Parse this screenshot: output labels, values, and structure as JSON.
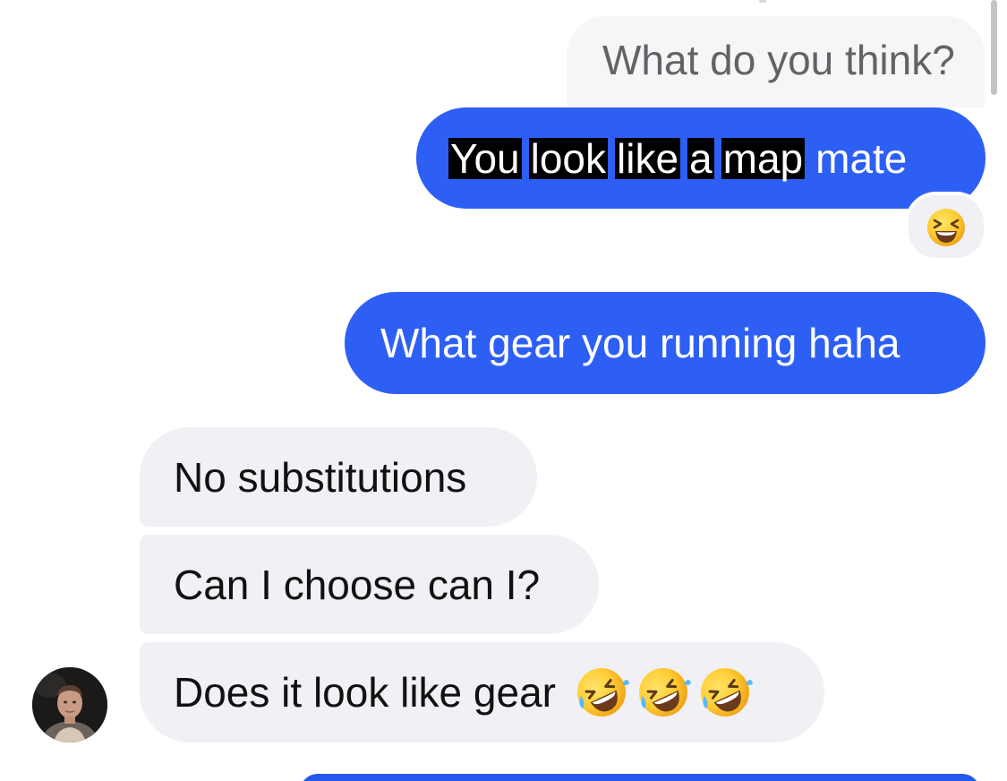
{
  "conversation": {
    "messages": [
      {
        "id": "m1",
        "direction": "outgoing-quoted",
        "text": "What do you think?"
      },
      {
        "id": "m2",
        "direction": "outgoing",
        "highlighted_words": [
          "You",
          "look",
          "like",
          "a",
          "map"
        ],
        "plain_tail": "mate"
      },
      {
        "id": "m3",
        "direction": "outgoing",
        "text": "What gear you running haha"
      },
      {
        "id": "m4",
        "direction": "incoming",
        "text": "No substitutions"
      },
      {
        "id": "m5",
        "direction": "incoming",
        "text": "Can I choose can I?"
      },
      {
        "id": "m6",
        "direction": "incoming",
        "text": "Does it look like gear"
      }
    ],
    "reaction": {
      "message_id": "m2",
      "emoji_name": "grinning-squinting-face-icon",
      "glyph": "😆"
    },
    "m6_emojis": [
      "rolling-on-floor-laughing-icon",
      "rolling-on-floor-laughing-icon",
      "rolling-on-floor-laughing-icon"
    ]
  },
  "colors": {
    "outgoing_bubble": "#2e5ff5",
    "incoming_bubble": "#f0f0f5",
    "quoted_bubble": "#f6f6f8",
    "highlight": "#000000"
  }
}
